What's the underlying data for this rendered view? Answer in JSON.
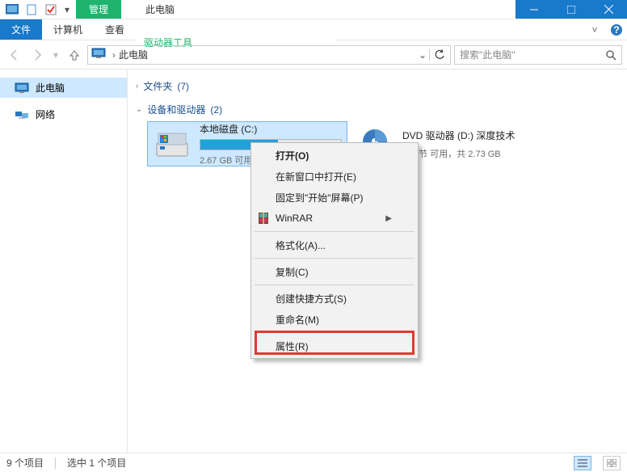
{
  "titlebar": {
    "manage_tab": "管理",
    "title": "此电脑"
  },
  "ribbon": {
    "file": "文件",
    "computer": "计算机",
    "view": "查看",
    "drive_tools": "驱动器工具"
  },
  "nav": {
    "breadcrumb": "此电脑",
    "search_placeholder": "搜索\"此电脑\""
  },
  "sidebar": {
    "this_pc": "此电脑",
    "network": "网络"
  },
  "groups": {
    "folders": {
      "label": "文件夹",
      "count": "(7)"
    },
    "devices": {
      "label": "设备和驱动器",
      "count": "(2)"
    }
  },
  "drives": {
    "c": {
      "name": "本地磁盘 (C:)",
      "subtitle": "2.67 GB 可用",
      "fill_pct": 55
    },
    "d": {
      "name": "DVD 驱动器 (D:) 深度技术",
      "subtitle": "0 字节 可用，共 2.73 GB"
    }
  },
  "context_menu": {
    "open": "打开(O)",
    "open_new_window": "在新窗口中打开(E)",
    "pin_start": "固定到\"开始\"屏幕(P)",
    "winrar": "WinRAR",
    "format": "格式化(A)...",
    "copy": "复制(C)",
    "create_shortcut": "创建快捷方式(S)",
    "rename": "重命名(M)",
    "properties": "属性(R)"
  },
  "status": {
    "items": "9 个项目",
    "selected": "选中 1 个项目"
  }
}
